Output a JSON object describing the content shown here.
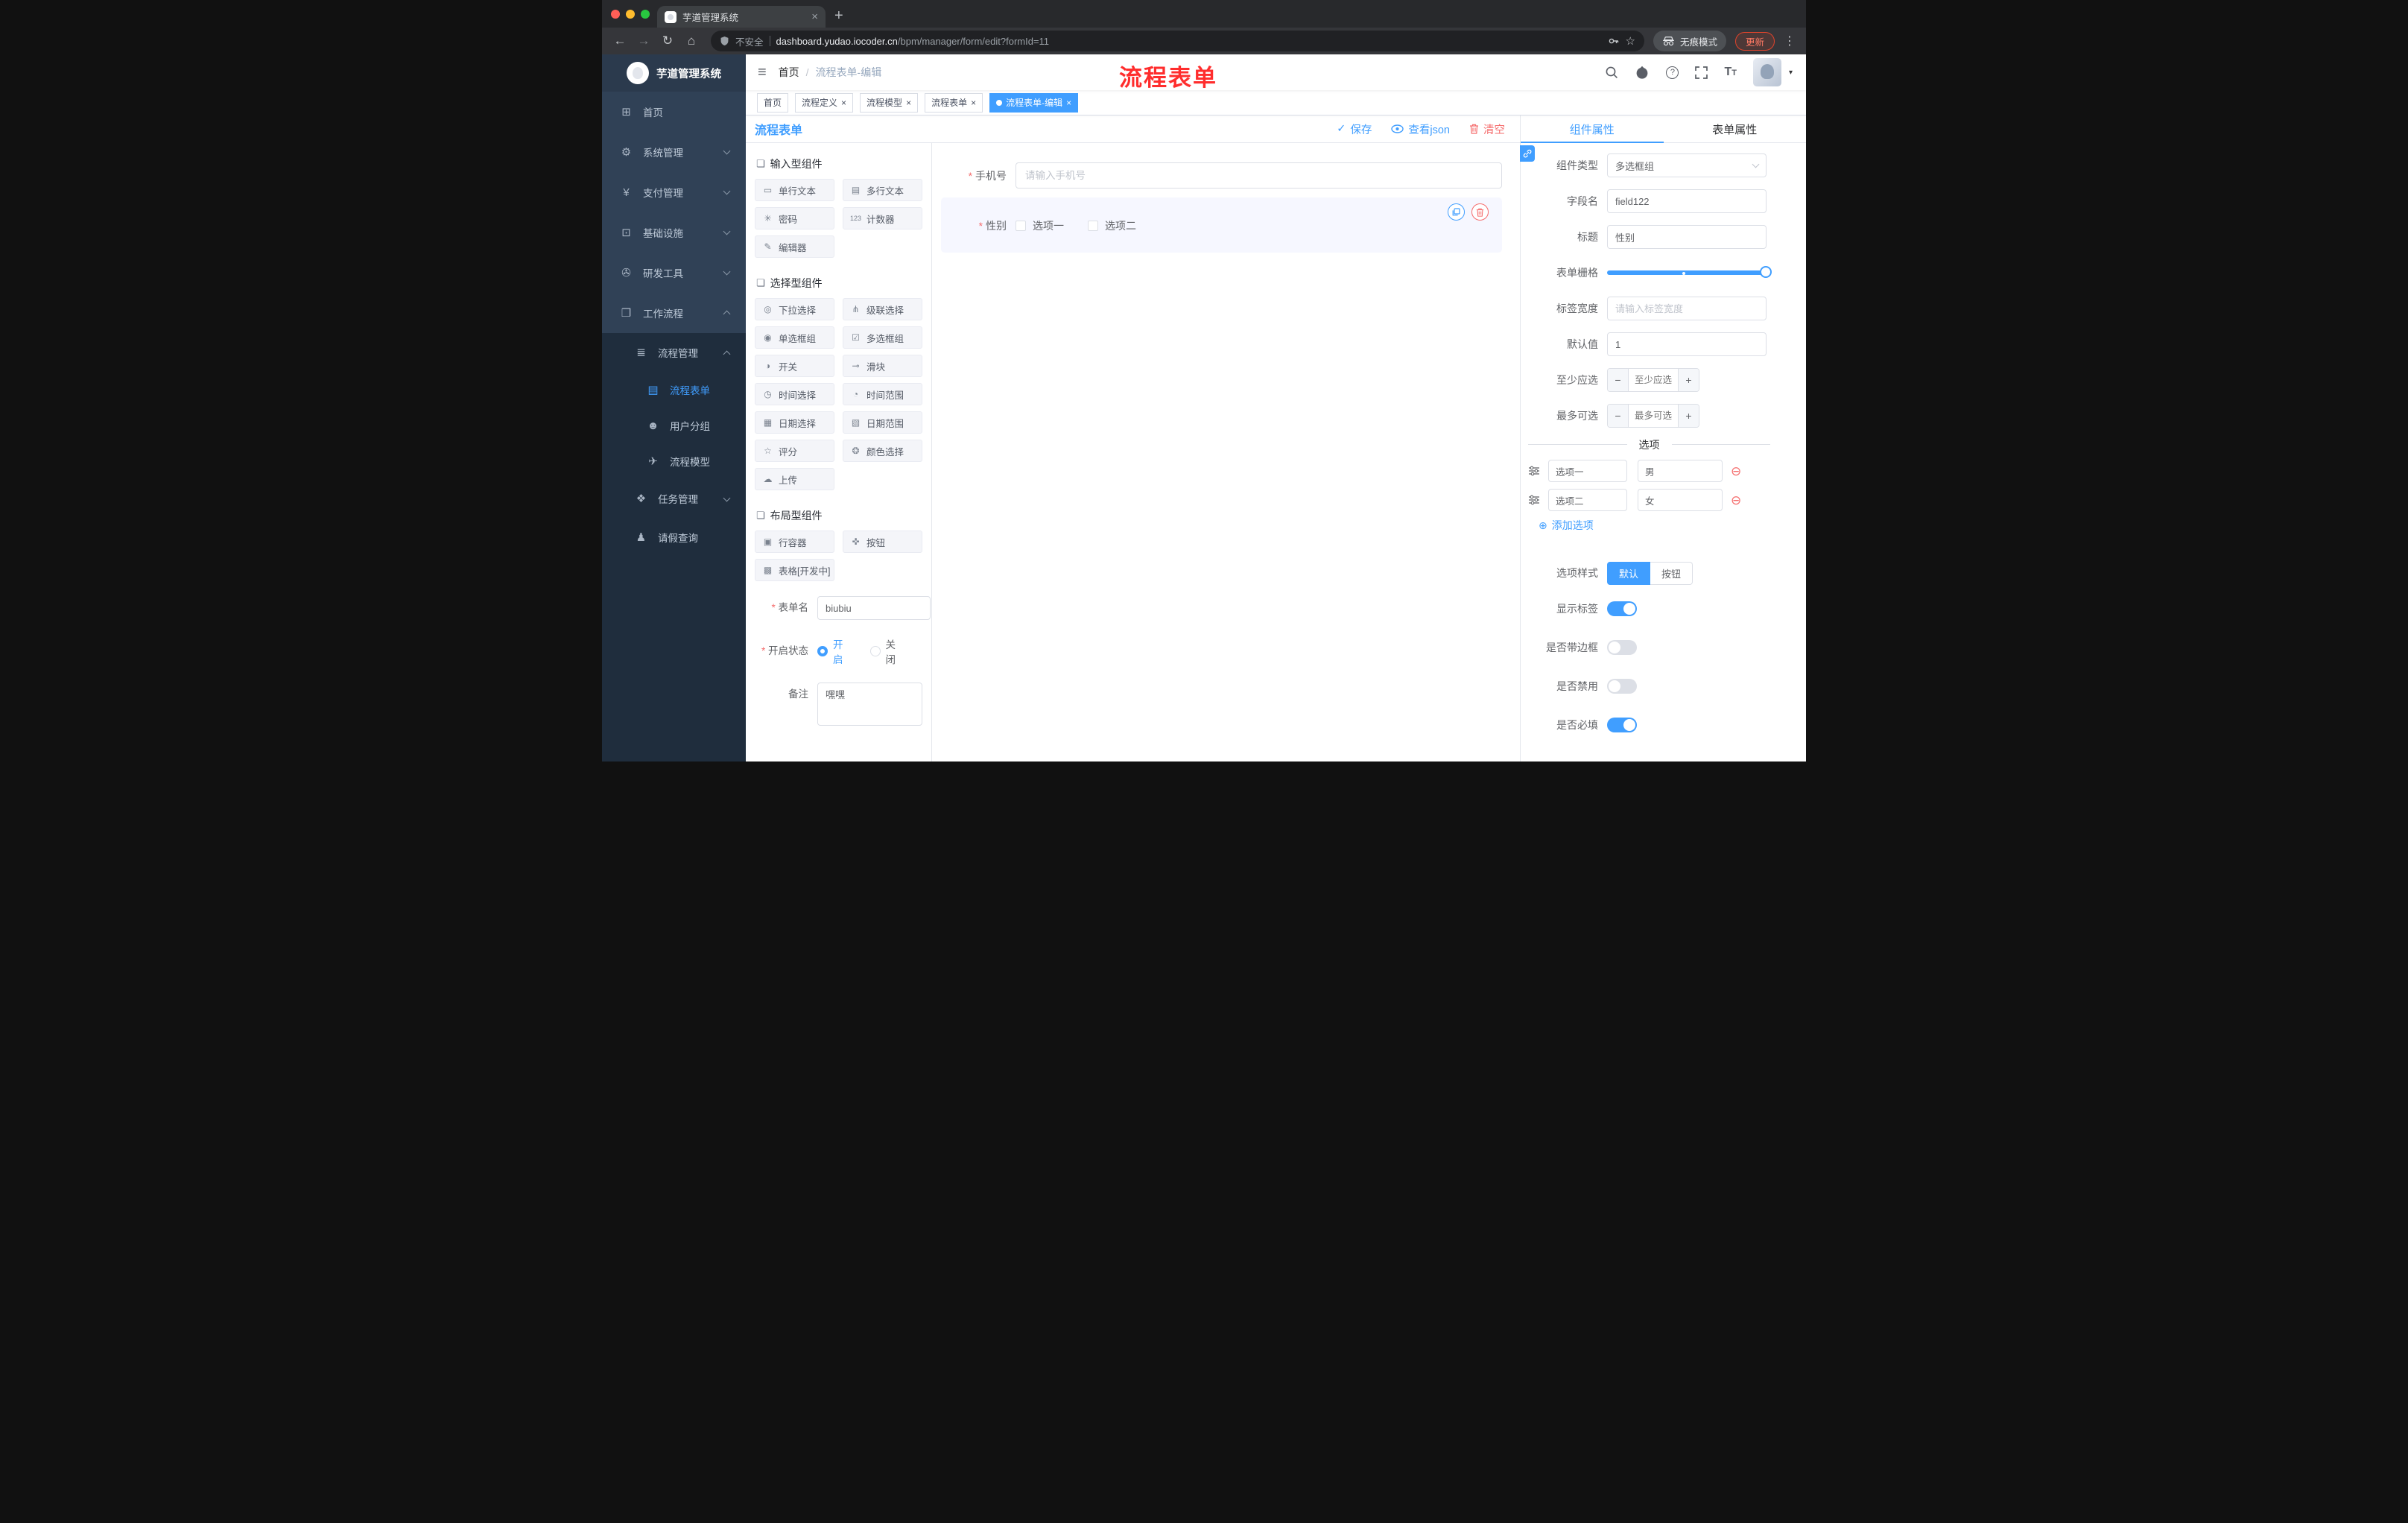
{
  "browser": {
    "tab_title": "芋道管理系统",
    "security_label": "不安全",
    "url_domain": "dashboard.yudao.iocoder.cn",
    "url_path": "/bpm/manager/form/edit?formId=11",
    "incognito_label": "无痕模式",
    "update_label": "更新"
  },
  "glyphs": {
    "close": "×",
    "plus": "+",
    "back": "←",
    "forward": "→",
    "reload": "↻",
    "home": "⌂",
    "dots": "⋮",
    "star": "☆",
    "caret": "▾",
    "hamburger": "≡",
    "slash": "/",
    "question": "?",
    "check": "✓",
    "add": "⊕",
    "remove": "⊖",
    "minus": "−",
    "font_big": "T",
    "font_small": "T"
  },
  "sidebar": {
    "logo_title": "芋道管理系统",
    "items": [
      {
        "label": "首页",
        "icon": "⊞"
      },
      {
        "label": "系统管理",
        "icon": "⚙"
      },
      {
        "label": "支付管理",
        "icon": "¥"
      },
      {
        "label": "基础设施",
        "icon": "⊡"
      },
      {
        "label": "研发工具",
        "icon": "✇"
      },
      {
        "label": "工作流程",
        "icon": "❒"
      },
      {
        "label": "流程管理",
        "icon": "≣"
      },
      {
        "label": "流程表单",
        "icon": "▤"
      },
      {
        "label": "用户分组",
        "icon": "☻"
      },
      {
        "label": "流程模型",
        "icon": "✈"
      },
      {
        "label": "任务管理",
        "icon": "❖"
      },
      {
        "label": "请假查询",
        "icon": "♟"
      }
    ]
  },
  "navbar": {
    "breadcrumb_home": "首页",
    "breadcrumb_current": "流程表单-编辑",
    "annotation": "流程表单"
  },
  "tags": [
    {
      "label": "首页"
    },
    {
      "label": "流程定义"
    },
    {
      "label": "流程模型"
    },
    {
      "label": "流程表单"
    },
    {
      "label": "流程表单-编辑"
    }
  ],
  "designer": {
    "title": "流程表单",
    "toolbar": {
      "save": "保存",
      "view_json": "查看json",
      "clear": "清空"
    },
    "palette": {
      "groups": [
        {
          "label": "输入型组件",
          "icon": "❏",
          "items": [
            {
              "label": "单行文本",
              "icon": "▭"
            },
            {
              "label": "多行文本",
              "icon": "▤"
            },
            {
              "label": "密码",
              "icon": "✳"
            },
            {
              "label": "计数器",
              "icon": "123"
            },
            {
              "label": "编辑器",
              "icon": "✎"
            }
          ]
        },
        {
          "label": "选择型组件",
          "icon": "❏",
          "items": [
            {
              "label": "下拉选择",
              "icon": "◎"
            },
            {
              "label": "级联选择",
              "icon": "⋔"
            },
            {
              "label": "单选框组",
              "icon": "◉"
            },
            {
              "label": "多选框组",
              "icon": "☑"
            },
            {
              "label": "开关",
              "icon": "◑"
            },
            {
              "label": "滑块",
              "icon": "⊸"
            },
            {
              "label": "时间选择",
              "icon": "◷"
            },
            {
              "label": "时间范围",
              "icon": "◔"
            },
            {
              "label": "日期选择",
              "icon": "▦"
            },
            {
              "label": "日期范围",
              "icon": "▧"
            },
            {
              "label": "评分",
              "icon": "☆"
            },
            {
              "label": "颜色选择",
              "icon": "❂"
            },
            {
              "label": "上传",
              "icon": "☁"
            }
          ]
        },
        {
          "label": "布局型组件",
          "icon": "❏",
          "items": [
            {
              "label": "行容器",
              "icon": "▣"
            },
            {
              "label": "按钮",
              "icon": "✜"
            },
            {
              "label": "表格[开发中]",
              "icon": "▩"
            }
          ]
        }
      ]
    },
    "form_meta": {
      "name_label": "表单名",
      "name_value": "biubiu",
      "status_label": "开启状态",
      "status_on": "开启",
      "status_off": "关闭",
      "remark_label": "备注",
      "remark_value": "嘿嘿"
    },
    "canvas": {
      "phone_label": "手机号",
      "phone_placeholder": "请输入手机号",
      "gender_label": "性别",
      "gender_options": [
        {
          "label": "选项一"
        },
        {
          "label": "选项二"
        }
      ]
    },
    "props": {
      "tab_component": "组件属性",
      "tab_form": "表单属性",
      "component_type_label": "组件类型",
      "component_type_value": "多选框组",
      "field_name_label": "字段名",
      "field_name_value": "field122",
      "title_label": "标题",
      "title_value": "性别",
      "grid_label": "表单栅格",
      "label_width_label": "标签宽度",
      "label_width_placeholder": "请输入标签宽度",
      "default_label": "默认值",
      "default_value": "1",
      "min_label": "至少应选",
      "min_placeholder": "至少应选",
      "max_label": "最多可选",
      "max_placeholder": "最多可选",
      "options_title": "选项",
      "options": [
        {
          "name": "选项一",
          "value": "男"
        },
        {
          "name": "选项二",
          "value": "女"
        }
      ],
      "add_option": "添加选项",
      "style_label": "选项样式",
      "style_default": "默认",
      "style_button": "按钮",
      "show_label": "显示标签",
      "with_border": "是否带边框",
      "disabled_label": "是否禁用",
      "required_label": "是否必填"
    }
  },
  "colors": {
    "primary": "#409eff",
    "danger": "#f56c6c",
    "annotation": "#ff2d2d"
  }
}
